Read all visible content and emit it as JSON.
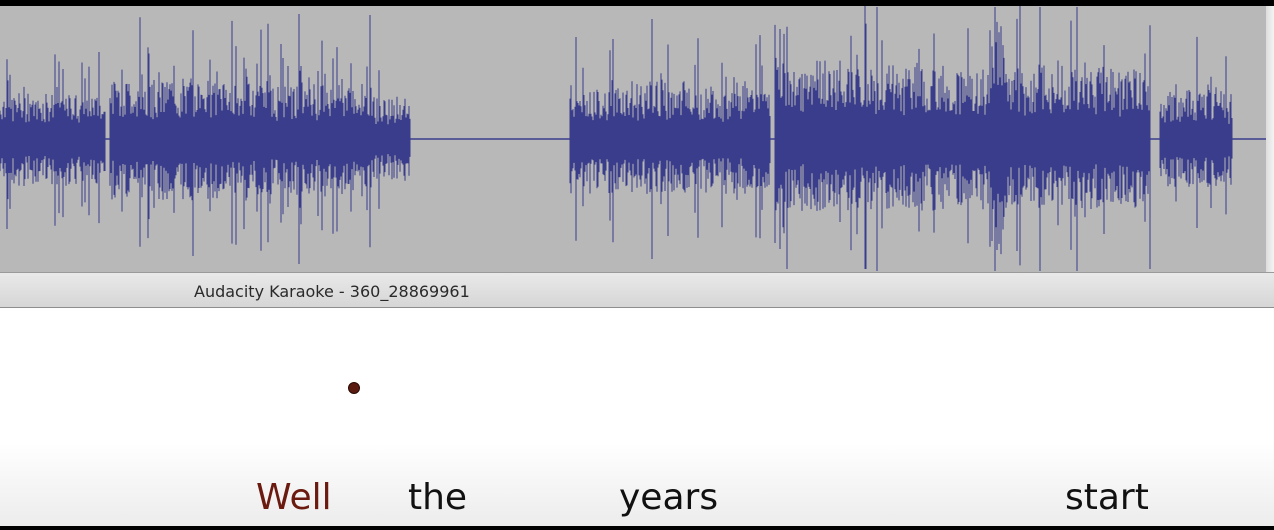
{
  "window": {
    "title": "Audacity Karaoke - 360_28869961"
  },
  "lyrics": [
    {
      "text": "Well",
      "state": "sung"
    },
    {
      "text": "the",
      "state": "upcoming"
    },
    {
      "text": "years",
      "state": "upcoming"
    },
    {
      "text": "start",
      "state": "upcoming"
    }
  ],
  "colors": {
    "waveform_background": "#b8b8b8",
    "waveform": "#3a3d8c",
    "sung_lyric": "#6b1a10",
    "lyric": "#111111",
    "ball": "#5a1a10"
  },
  "icons": {
    "ball": "bouncing-ball-icon"
  }
}
